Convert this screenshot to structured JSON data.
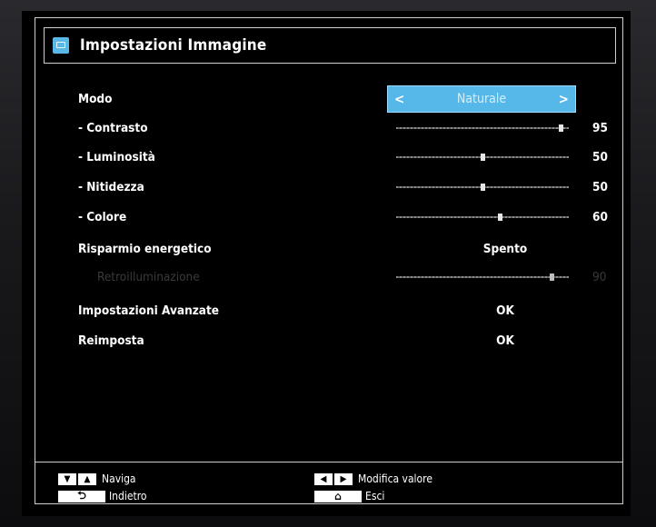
{
  "window": {
    "title": "Impostazioni Immagine",
    "title_icon": "picture-settings-icon"
  },
  "settings": {
    "mode": {
      "label": "Modo",
      "value": "Naturale"
    },
    "contrast": {
      "label": "- Contrasto",
      "value": "95",
      "level": 0.95
    },
    "brightness": {
      "label": "- Luminosità",
      "value": "50",
      "level": 0.5
    },
    "sharpness": {
      "label": "- Nitidezza",
      "value": "50",
      "level": 0.5
    },
    "color": {
      "label": "- Colore",
      "value": "60",
      "level": 0.6
    },
    "energy_saving": {
      "label": "Risparmio energetico",
      "value": "Spento"
    },
    "backlight": {
      "label": "Retroilluminazione",
      "value": "90",
      "level": 0.9,
      "enabled": false
    },
    "advanced": {
      "label": "Impostazioni Avanzate",
      "value": "OK"
    },
    "reset": {
      "label": "Reimposta",
      "value": "OK"
    }
  },
  "footer": {
    "navigate": {
      "label": "Naviga",
      "icon": "up-down-arrows-icon"
    },
    "modify": {
      "label": "Modifica valore",
      "icon": "left-right-arrows-icon"
    },
    "back": {
      "label": "Indietro",
      "icon": "return-icon"
    },
    "exit": {
      "label": "Esci",
      "icon": "home-icon"
    }
  },
  "colors": {
    "accent": "#55b8e8",
    "text": "#ffffff",
    "disabled": "#3a3a3a",
    "background": "#000000"
  }
}
